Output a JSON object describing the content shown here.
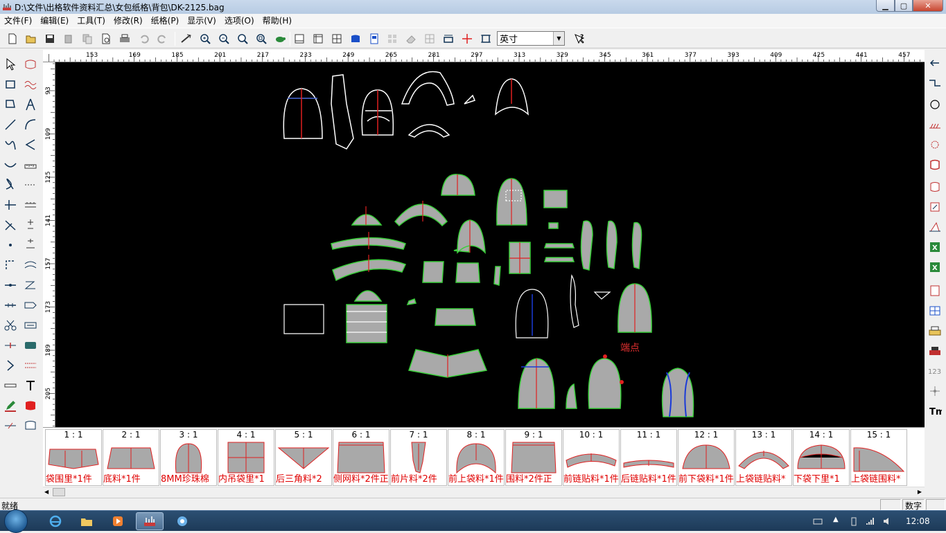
{
  "window": {
    "title": "D:\\文件\\出格软件资料汇总\\女包纸格\\背包\\DK-2125.bag",
    "app_icon": "ruler-pattern-icon"
  },
  "menu": [
    "文件(F)",
    "编辑(E)",
    "工具(T)",
    "修改(R)",
    "纸格(P)",
    "显示(V)",
    "选项(O)",
    "帮助(H)"
  ],
  "toolbar": {
    "icons": [
      "new-file-icon",
      "open-folder-icon",
      "save-icon",
      "paste-icon",
      "copy-icon",
      "print-preview-icon",
      "print-icon",
      "undo-icon",
      "redo-icon",
      "measure-icon",
      "zoom-in-icon",
      "zoom-out-icon",
      "zoom-fit-icon",
      "zoom-all-icon",
      "turtle-icon",
      "view-single-icon",
      "view-ruler-icon",
      "grid-view-icon",
      "fill-icon",
      "layout-icon",
      "tile-icon",
      "eraser-icon",
      "group-icon",
      "dimension-icon",
      "cross-icon",
      "select-frame-icon",
      "help-icon"
    ],
    "unit_value": "英寸"
  },
  "ruler": {
    "h_ticks": [
      "153",
      "169",
      "185",
      "201",
      "217",
      "233",
      "249",
      "265",
      "281",
      "297",
      "313",
      "329",
      "345",
      "361",
      "377",
      "393",
      "409",
      "425",
      "441",
      "457"
    ],
    "v_ticks": [
      "93",
      "109",
      "125",
      "141",
      "157",
      "173",
      "189",
      "205"
    ]
  },
  "canvas": {
    "endpoint_label": "端点"
  },
  "pieces": [
    {
      "ratio": "1 : 1",
      "name": "袋围里*1件"
    },
    {
      "ratio": "2 : 1",
      "name": "底料*1件"
    },
    {
      "ratio": "3 : 1",
      "name": "8MM珍珠棉"
    },
    {
      "ratio": "4 : 1",
      "name": "内吊袋里*1"
    },
    {
      "ratio": "5 : 1",
      "name": "后三角料*2"
    },
    {
      "ratio": "6 : 1",
      "name": "侧网料*2件正"
    },
    {
      "ratio": "7 : 1",
      "name": "前片料*2件"
    },
    {
      "ratio": "8 : 1",
      "name": "前上袋料*1件"
    },
    {
      "ratio": "9 : 1",
      "name": "围料*2件正"
    },
    {
      "ratio": "10 : 1",
      "name": "前链贴料*1件"
    },
    {
      "ratio": "11 : 1",
      "name": "后链贴料*1件"
    },
    {
      "ratio": "12 : 1",
      "name": "前下袋料*1件"
    },
    {
      "ratio": "13 : 1",
      "name": "上袋链贴料*"
    },
    {
      "ratio": "14 : 1",
      "name": "下袋下里*1"
    },
    {
      "ratio": "15 : 1",
      "name": "上袋链围料*"
    }
  ],
  "status": {
    "text": "就绪",
    "numlock": "数字"
  },
  "taskbar": {
    "clock": "12:08"
  }
}
